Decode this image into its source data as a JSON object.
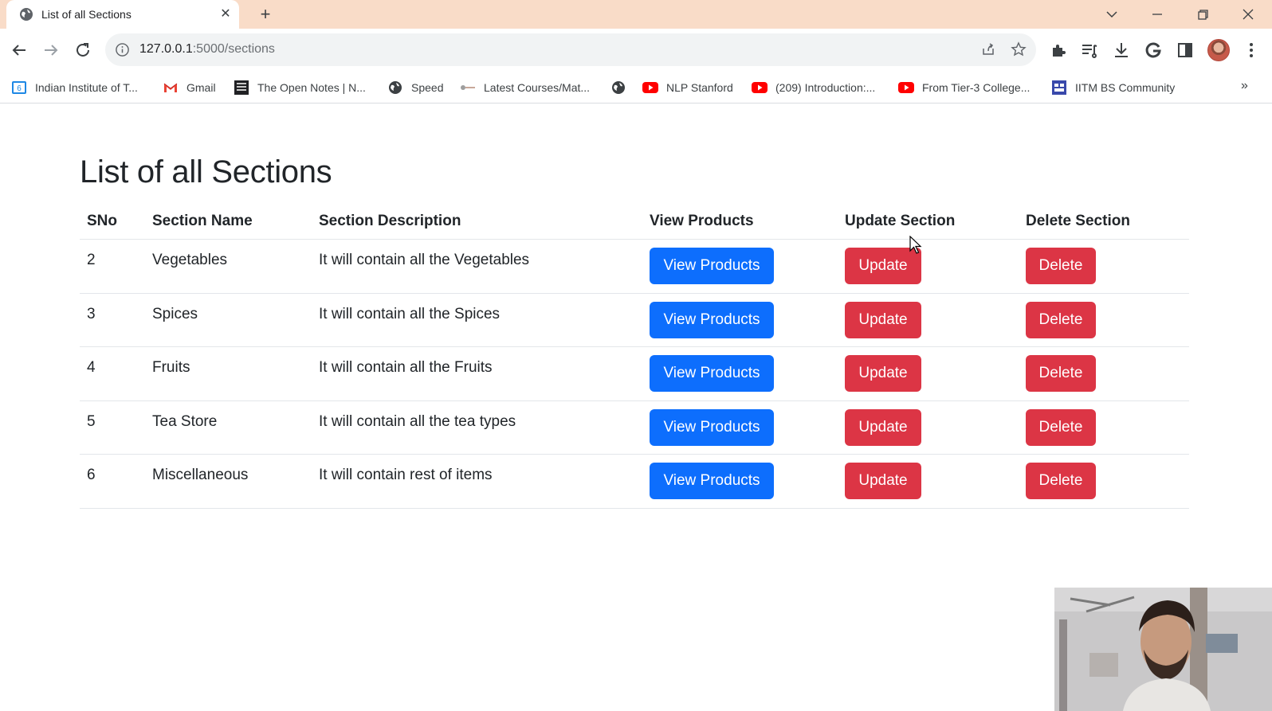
{
  "browser": {
    "tab_title": "List of all Sections",
    "url_host": "127.0.0.1",
    "url_path": ":5000/sections",
    "bookmarks": [
      {
        "label": "Indian Institute of T...",
        "icon": "google-classroom-icon"
      },
      {
        "label": "Gmail",
        "icon": "gmail-icon"
      },
      {
        "label": "The Open Notes | N...",
        "icon": "notes-icon"
      },
      {
        "label": "Speed",
        "icon": "globe-icon"
      },
      {
        "label": "Latest Courses/Mat...",
        "icon": "link-icon"
      },
      {
        "label": "",
        "icon": "globe-icon"
      },
      {
        "label": "NLP Stanford",
        "icon": "youtube-icon"
      },
      {
        "label": "(209) Introduction:...",
        "icon": "youtube-icon"
      },
      {
        "label": "From Tier-3 College...",
        "icon": "youtube-icon"
      },
      {
        "label": "IITM BS Community",
        "icon": "community-icon"
      }
    ]
  },
  "page": {
    "title": "List of all Sections",
    "headers": {
      "sno": "SNo",
      "name": "Section Name",
      "description": "Section Description",
      "view": "View Products",
      "update": "Update Section",
      "delete": "Delete Section"
    },
    "rows": [
      {
        "sno": "2",
        "name": "Vegetables",
        "description": "It will contain all the Vegetables",
        "view_label": "View Products",
        "update_label": "Update",
        "delete_label": "Delete"
      },
      {
        "sno": "3",
        "name": "Spices",
        "description": "It will contain all the Spices",
        "view_label": "View Products",
        "update_label": "Update",
        "delete_label": "Delete"
      },
      {
        "sno": "4",
        "name": "Fruits",
        "description": "It will contain all the Fruits",
        "view_label": "View Products",
        "update_label": "Update",
        "delete_label": "Delete"
      },
      {
        "sno": "5",
        "name": "Tea Store",
        "description": "It will contain all the tea types",
        "view_label": "View Products",
        "update_label": "Update",
        "delete_label": "Delete"
      },
      {
        "sno": "6",
        "name": "Miscellaneous",
        "description": "It will contain rest of items",
        "view_label": "View Products",
        "update_label": "Update",
        "delete_label": "Delete"
      }
    ]
  },
  "colors": {
    "primary": "#0d6efd",
    "danger": "#dc3545",
    "tabstrip": "#f9dcc8"
  }
}
